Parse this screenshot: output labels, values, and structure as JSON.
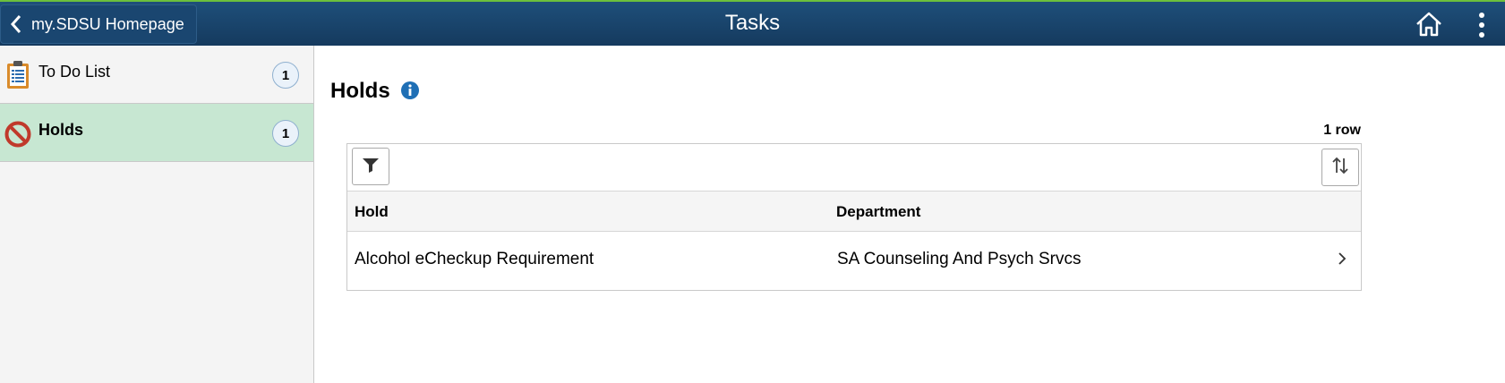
{
  "header": {
    "back_label": "my.SDSU Homepage",
    "title": "Tasks",
    "accent_color": "#6cbf3c",
    "bar_color": "#153a5e"
  },
  "sidebar": {
    "items": [
      {
        "label": "To Do List",
        "count": "1",
        "icon": "clipboard-list-icon",
        "active": false
      },
      {
        "label": "Holds",
        "count": "1",
        "icon": "no-entry-icon",
        "active": true
      }
    ]
  },
  "main": {
    "title": "Holds",
    "row_count": "1 row",
    "columns": [
      "Hold",
      "Department"
    ],
    "rows": [
      {
        "hold": "Alcohol eCheckup Requirement",
        "department": "SA Counseling And Psych Srvcs"
      }
    ]
  }
}
